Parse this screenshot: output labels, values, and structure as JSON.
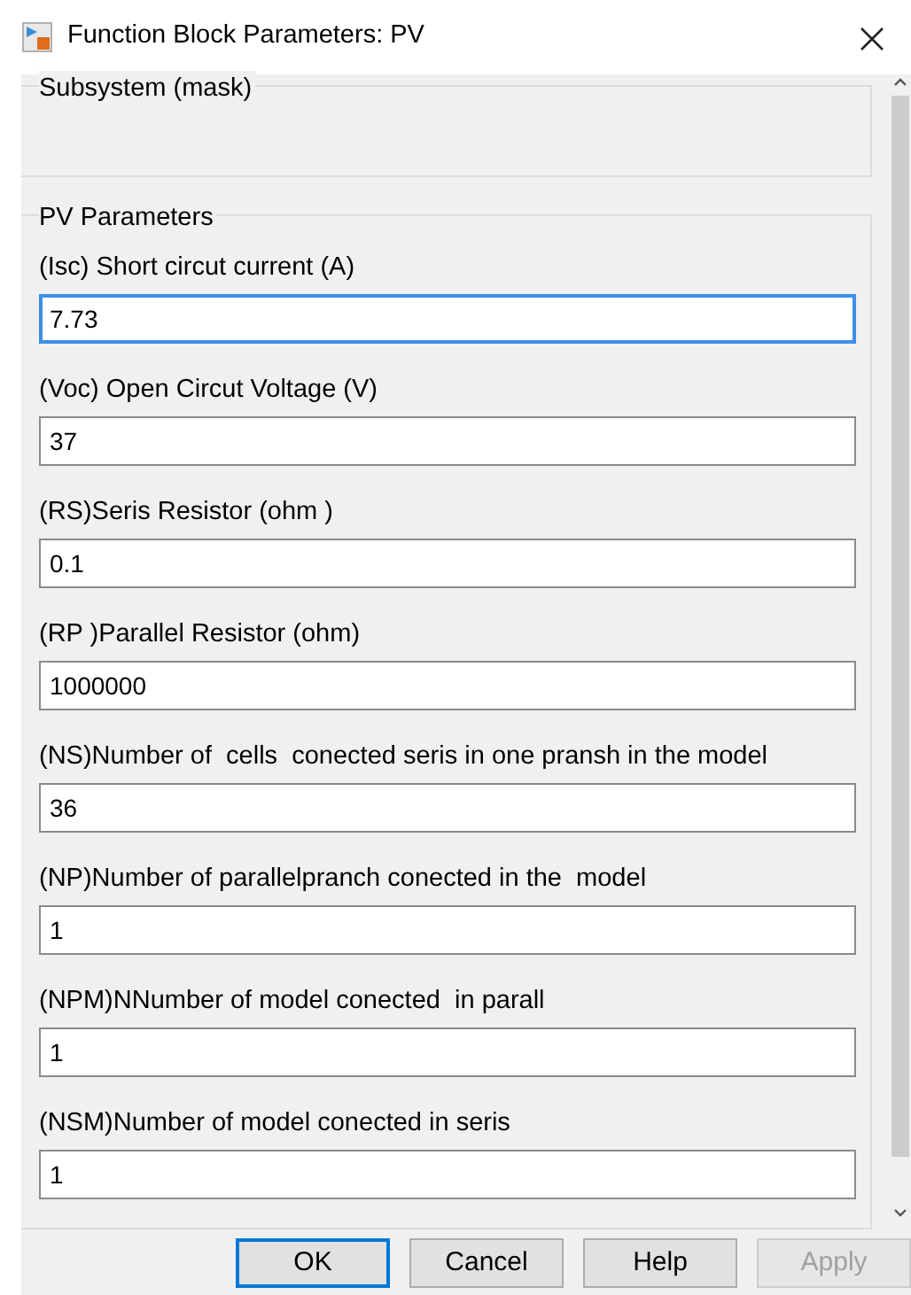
{
  "window": {
    "title": "Function Block Parameters: PV"
  },
  "mask_group": {
    "title": "Subsystem (mask)"
  },
  "parameters_group": {
    "title": "PV Parameters"
  },
  "fields": [
    {
      "label": "(Isc) Short circut current (A)",
      "value": "7.73",
      "focused": true
    },
    {
      "label": "(Voc) Open Circut Voltage (V)",
      "value": "37",
      "focused": false
    },
    {
      "label": "(RS)Seris Resistor (ohm )",
      "value": "0.1",
      "focused": false
    },
    {
      "label": "(RP )Parallel Resistor (ohm)",
      "value": "1000000",
      "focused": false
    },
    {
      "label": "(NS)Number of  cells  conected seris in one pransh in the model",
      "value": "36",
      "focused": false
    },
    {
      "label": "(NP)Number of parallelpranch conected in the  model",
      "value": "1",
      "focused": false
    },
    {
      "label": "(NPM)NNumber of model conected  in parall",
      "value": "1",
      "focused": false
    },
    {
      "label": "(NSM)Number of model conected in seris",
      "value": "1",
      "focused": false
    }
  ],
  "buttons": [
    {
      "label": "OK",
      "selected": true,
      "disabled": false
    },
    {
      "label": "Cancel",
      "selected": false,
      "disabled": false
    },
    {
      "label": "Help",
      "selected": false,
      "disabled": false
    },
    {
      "label": "Apply",
      "selected": false,
      "disabled": true
    }
  ]
}
